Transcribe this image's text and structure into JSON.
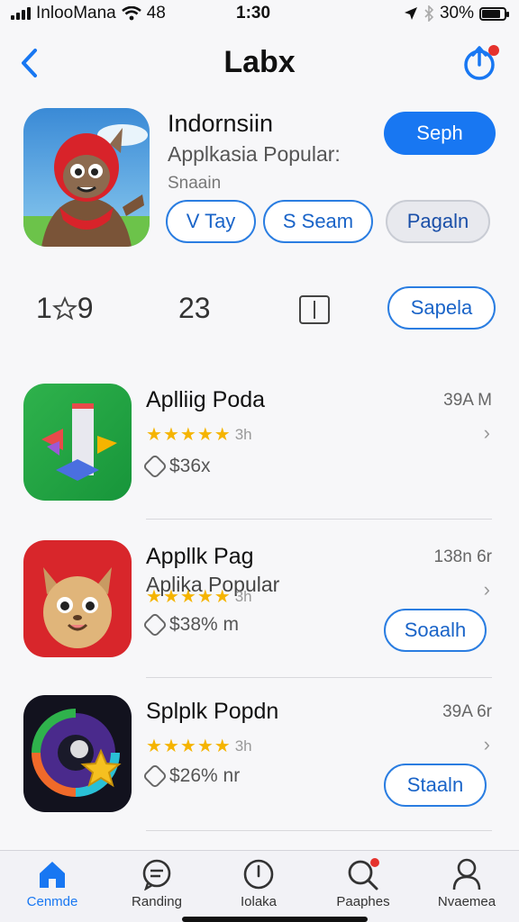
{
  "status_bar": {
    "carrier": "InlooMana",
    "network": "48",
    "time": "1:30",
    "battery": "30%"
  },
  "nav": {
    "title": "Labx",
    "back_icon": "chevron-left-icon",
    "share_icon": "share-icon"
  },
  "hero": {
    "title": "Indornsiin",
    "subtitle": "Applkasia Popular:",
    "subtext": "Snaain",
    "primary_button": "Seph",
    "pills": [
      "V Tay",
      "S Seam",
      "Pagaln"
    ]
  },
  "stats": {
    "rating": "1",
    "rating_suffix": "9",
    "count": "23",
    "button": "Sapela"
  },
  "apps": [
    {
      "name": "Aplliig Poda",
      "size": "39A M",
      "stars": 4.5,
      "count": "3h",
      "price": "$36x",
      "button": ""
    },
    {
      "name": "Appllk Pag",
      "subtitle": "Aplika Popular",
      "size": "138n 6r",
      "stars": 4.5,
      "count": "3h",
      "price": "$38% m",
      "button": "Soaalh"
    },
    {
      "name": "Splplk Popdn",
      "size": "39A 6r",
      "stars": 4.5,
      "count": "3h",
      "price": "$26% nr",
      "button": "Staaln"
    }
  ],
  "tabbar": {
    "tabs": [
      {
        "label": "Cenmde",
        "icon": "home-icon",
        "active": true
      },
      {
        "label": "Randing",
        "icon": "chat-icon",
        "active": false
      },
      {
        "label": "Iolaka",
        "icon": "clock-icon",
        "active": false
      },
      {
        "label": "Paaphes",
        "icon": "search-icon",
        "active": false
      },
      {
        "label": "Nvaemea",
        "icon": "profile-icon",
        "active": false
      }
    ]
  },
  "colors": {
    "accent": "#1877f2",
    "star": "#f5b400",
    "badge": "#e5322d"
  }
}
